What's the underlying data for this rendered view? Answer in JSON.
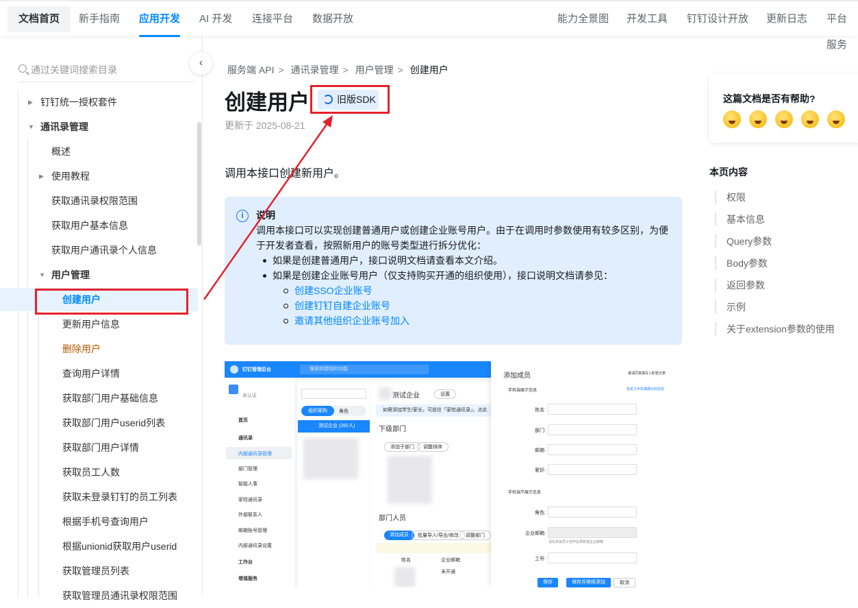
{
  "topnav": {
    "left": [
      "文档首页",
      "新手指南",
      "应用开发",
      "AI 开发",
      "连接平台",
      "数据开放"
    ],
    "right": [
      "能力全景图",
      "开发工具",
      "钉钉设计开放",
      "更新日志",
      "平台服务"
    ],
    "active": "应用开发"
  },
  "sidebar": {
    "search_placeholder": "通过关键词搜索目录",
    "items": [
      {
        "label": "钉钉统一授权套件"
      },
      {
        "label": "通讯录管理"
      },
      {
        "label": "概述"
      },
      {
        "label": "使用教程"
      },
      {
        "label": "获取通讯录权限范围"
      },
      {
        "label": "获取用户基本信息"
      },
      {
        "label": "获取用户通讯录个人信息"
      },
      {
        "label": "用户管理"
      },
      {
        "label": "创建用户"
      },
      {
        "label": "更新用户信息"
      },
      {
        "label": "删除用户"
      },
      {
        "label": "查询用户详情"
      },
      {
        "label": "获取部门用户基础信息"
      },
      {
        "label": "获取部门用户userid列表"
      },
      {
        "label": "获取部门用户详情"
      },
      {
        "label": "获取员工人数"
      },
      {
        "label": "获取未登录钉钉的员工列表"
      },
      {
        "label": "根据手机号查询用户"
      },
      {
        "label": "根据unionid获取用户userid"
      },
      {
        "label": "获取管理员列表"
      },
      {
        "label": "获取管理员通讯录权限范围"
      }
    ]
  },
  "breadcrumb": [
    "服务端 API",
    "通讯录管理",
    "用户管理",
    "创建用户"
  ],
  "page": {
    "title": "创建用户",
    "sdk_button": "旧版SDK",
    "updated": "更新于 2025-08-21",
    "intro": "调用本接口创建新用户。"
  },
  "note": {
    "title": "说明",
    "body": "调用本接口可以实现创建普通用户或创建企业账号用户。由于在调用时参数使用有较多区别，为便于开发者查看，按照新用户的账号类型进行拆分优化：",
    "bullets": [
      "如果是创建普通用户，接口说明文档请查看本文介绍。",
      "如果是创建企业账号用户（仅支持购买开通的组织使用），接口说明文档请参见："
    ],
    "links": [
      "创建SSO企业账号",
      "创建钉钉自建企业账号",
      "邀请其他组织企业账号加入"
    ]
  },
  "screenshot": {
    "app": "钉钉管理后台",
    "search": "搜索你想找的功能",
    "unverified": "未认证",
    "nav": [
      "首页",
      "通讯录",
      "内部通讯录管理",
      "部门管理",
      "智能人事",
      "家校通讯录",
      "外部联系人",
      "邮箱账号管理",
      "内部通讯录设置",
      "工作台",
      "增值服务"
    ],
    "tabs": [
      "组织架构",
      "角色"
    ],
    "org": "测试企业 (282人)",
    "company": "测试企业",
    "settings": "设置",
    "tip": "如需添加学生/家长，可前往「家校通讯录」，点此",
    "subdept": "下级部门",
    "add_sub": "添加子部门",
    "adjust": "调整排序",
    "members": "部门人员",
    "add_member": "添加成员",
    "batch": "批量导入/导出/修改",
    "adjust_dept": "调整部门",
    "cols": [
      "姓名",
      "企业邮箱"
    ],
    "not_open": "未开通",
    "dialog": {
      "title": "添加成员",
      "invite": "邀请同事填写入职登记表",
      "sec1": "手机端展示信息",
      "custom": "自定义手机端展示的信息",
      "fields": [
        "姓名:",
        "部门:",
        "邮箱:",
        "爱好:"
      ],
      "sec2": "手机端不展示信息",
      "fields2": [
        "角色:",
        "企业邮箱:",
        "工号:"
      ],
      "email_hint": "请先添加员工完毕后再新建企业邮箱",
      "save": "保存",
      "save_continue": "保存并继续添加",
      "cancel": "取消"
    }
  },
  "feedback": {
    "title": "这篇文档是否有帮助?",
    "emojis": [
      "angry-emoji",
      "sweat-emoji",
      "smile-emoji",
      "grin-emoji",
      "heart-eyes-emoji"
    ]
  },
  "toc": {
    "title": "本页内容",
    "items": [
      "权限",
      "基本信息",
      "Query参数",
      "Body参数",
      "返回参数",
      "示例",
      "关于extension参数的使用"
    ]
  },
  "colors": {
    "accent": "#0089ff",
    "highlight": "#e5212c",
    "note_bg": "#e1eefe"
  }
}
